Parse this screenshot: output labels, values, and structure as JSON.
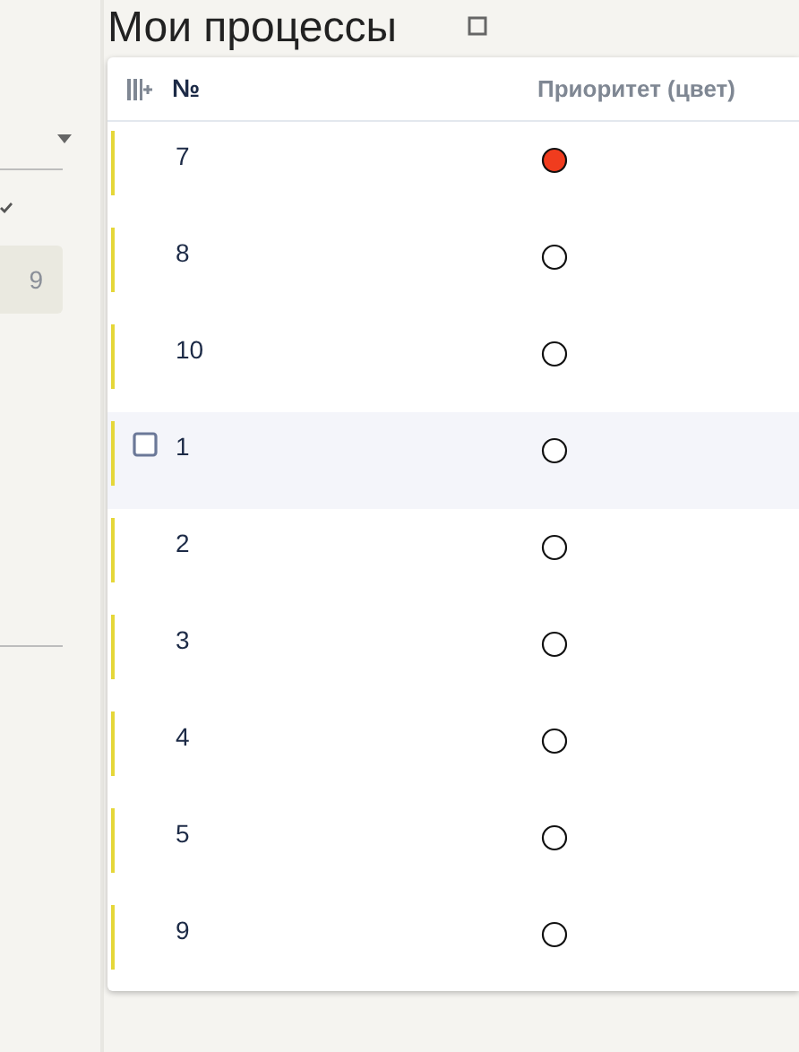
{
  "page_title": "Мои процессы",
  "sidebar": {
    "items": [
      {
        "kind": "dropdown"
      },
      {
        "kind": "check"
      },
      {
        "kind": "count",
        "count": "9",
        "selected": true
      }
    ]
  },
  "table": {
    "columns": [
      "№",
      "Приоритет (цвет)"
    ],
    "rows": [
      {
        "number": "7",
        "priority_set": true,
        "hovered": false
      },
      {
        "number": "8",
        "priority_set": false,
        "hovered": false
      },
      {
        "number": "10",
        "priority_set": false,
        "hovered": false
      },
      {
        "number": "1",
        "priority_set": false,
        "hovered": true
      },
      {
        "number": "2",
        "priority_set": false,
        "hovered": false
      },
      {
        "number": "3",
        "priority_set": false,
        "hovered": false
      },
      {
        "number": "4",
        "priority_set": false,
        "hovered": false
      },
      {
        "number": "5",
        "priority_set": false,
        "hovered": false
      },
      {
        "number": "9",
        "priority_set": false,
        "hovered": false
      }
    ]
  }
}
